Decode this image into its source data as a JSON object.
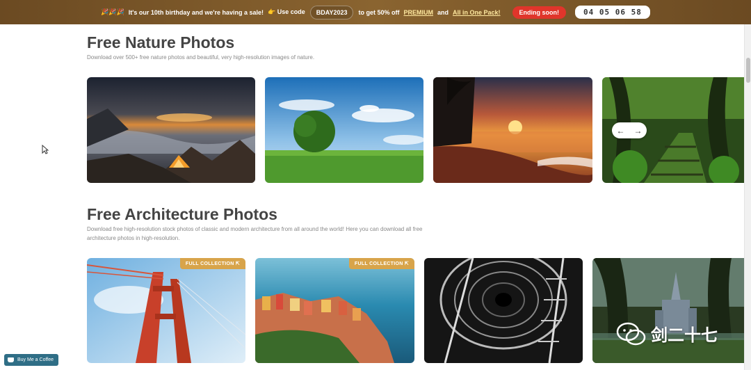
{
  "banner": {
    "emoji": "🎉🎉🎉",
    "text1": "It's our 10th birthday and we're having a sale!",
    "text2": "👉 Use code",
    "code": "BDAY2023",
    "text3": "to get 50% off",
    "premium": "PREMIUM",
    "and": "and",
    "allinone": "All in One Pack!",
    "ending": "Ending soon!",
    "timer": "04 05 06 58"
  },
  "nature": {
    "title": "Free Nature Photos",
    "description": "Download over 500+ free nature photos and beautiful, very high-resolution images of nature.",
    "nav_prev": "←",
    "nav_next": "→"
  },
  "architecture": {
    "title": "Free Architecture Photos",
    "description": "Download free high-resolution stock photos of classic and modern architecture from all around the world! Here you can download all free architecture photos in high-resolution.",
    "badge": "FULL COLLECTION ⇱"
  },
  "coffee": {
    "label": "Buy Me a Coffee"
  },
  "watermark": {
    "text": "剑二十七"
  }
}
